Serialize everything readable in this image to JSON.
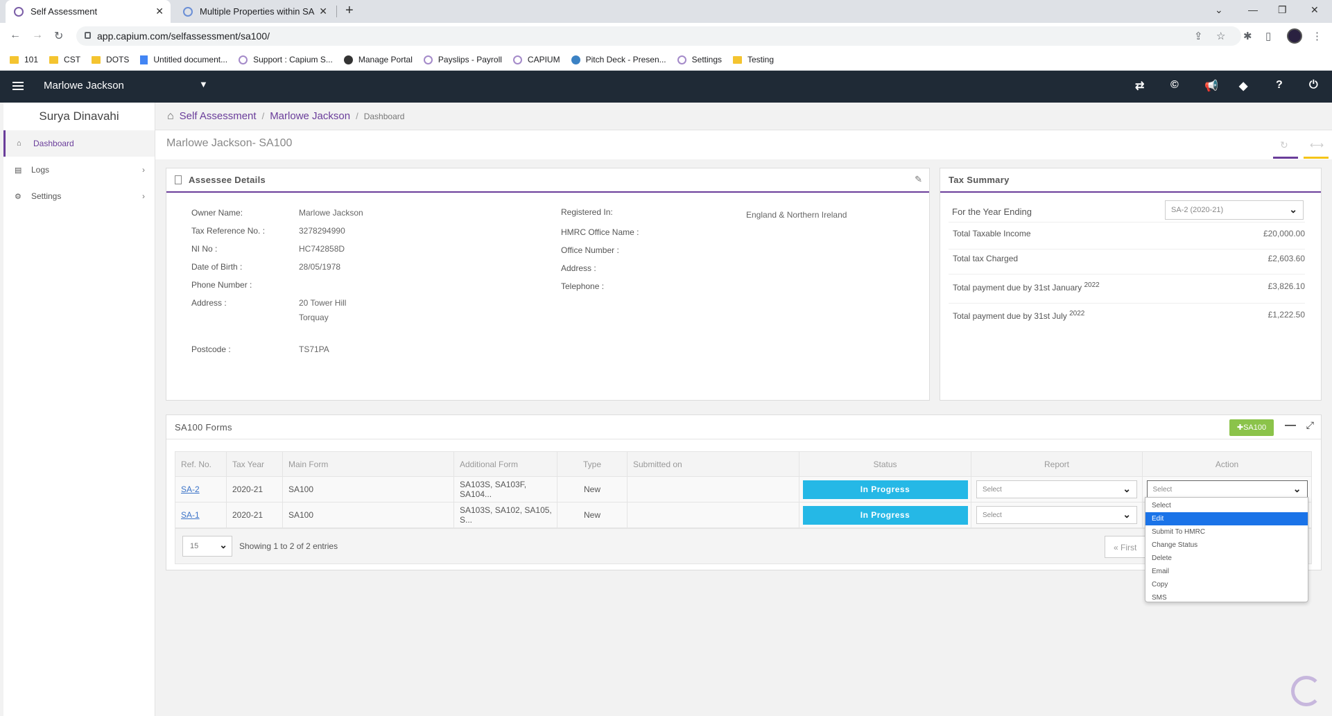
{
  "browser": {
    "tabs": [
      {
        "title": "Self Assessment",
        "active": true
      },
      {
        "title": "Multiple Properties within SA",
        "active": false
      }
    ],
    "url": "app.capium.com/selfassessment/sa100/",
    "bookmarks": [
      "101",
      "CST",
      "DOTS",
      "Untitled document...",
      "Support : Capium S...",
      "Manage Portal",
      "Payslips - Payroll",
      "CAPIUM",
      "Pitch Deck - Presen...",
      "Settings",
      "Testing"
    ]
  },
  "header": {
    "client_name": "Marlowe Jackson",
    "icons": [
      "swap-icon",
      "capium-icon",
      "megaphone-icon",
      "tag-icon",
      "help-icon",
      "power-icon"
    ]
  },
  "sidebar": {
    "user_name": "Surya Dinavahi",
    "items": [
      {
        "label": "Dashboard",
        "icon": "home-icon",
        "active": true
      },
      {
        "label": "Logs",
        "icon": "file-icon",
        "active": false
      },
      {
        "label": "Settings",
        "icon": "gear-icon",
        "active": false
      }
    ]
  },
  "breadcrumb": {
    "items": [
      "Self Assessment",
      "Marlowe Jackson",
      "Dashboard"
    ]
  },
  "page_title": "Marlowe Jackson- SA100",
  "assessee": {
    "heading": "Assessee Details",
    "left_labels": [
      "Owner Name:",
      "Tax Reference No. :",
      "NI No :",
      "Date of Birth :",
      "Phone Number :",
      "Address :",
      "Postcode :"
    ],
    "left_values": [
      "Marlowe Jackson",
      "3278294990",
      "HC742858D",
      "28/05/1978",
      "",
      "20 Tower Hill",
      "Torquay",
      "TS71PA"
    ],
    "right_labels": [
      "Registered In:",
      "HMRC Office Name :",
      "Office Number :",
      "Address :",
      "Telephone :"
    ],
    "registered_in": "England & Northern Ireland"
  },
  "tax_summary": {
    "heading": "Tax Summary",
    "year_label": "For the Year Ending",
    "year_select": "SA-2 (2020-21)",
    "rows": [
      {
        "label": "Total Taxable Income",
        "amount": "£20,000.00"
      },
      {
        "label": "Total tax Charged",
        "amount": "£2,603.60"
      },
      {
        "label": "Total payment due by 31st January",
        "sup": "2022",
        "amount": "£3,826.10"
      },
      {
        "label": "Total payment due by 31st July",
        "sup": "2022",
        "amount": "£1,222.50"
      }
    ]
  },
  "forms": {
    "heading": "SA100 Forms",
    "add_button": "SA100",
    "columns": [
      "Ref. No.",
      "Tax Year",
      "Main Form",
      "Additional Form",
      "Type",
      "Submitted on",
      "Status",
      "Report",
      "Action"
    ],
    "rows": [
      {
        "ref": "SA-2",
        "year": "2020-21",
        "main": "SA100",
        "additional": "SA103S, SA103F, SA104...",
        "type": "New",
        "submitted": "",
        "status": "In Progress",
        "report": "Select",
        "action": "Select"
      },
      {
        "ref": "SA-1",
        "year": "2020-21",
        "main": "SA100",
        "additional": "SA103S, SA102, SA105, S...",
        "type": "New",
        "submitted": "",
        "status": "In Progress",
        "report": "Select",
        "action": ""
      }
    ],
    "page_size": "15",
    "entries_text": "Showing 1 to 2 of 2 entries",
    "first_button": "« First",
    "action_options": [
      "Select",
      "Edit",
      "Submit To HMRC",
      "Change Status",
      "Delete",
      "Email",
      "Copy",
      "SMS"
    ],
    "highlighted_option": "Edit"
  },
  "colors": {
    "accent": "#6a3d9a",
    "status": "#25b8e6",
    "add_button": "#8bc34a",
    "header_bg": "#1f2a36"
  }
}
